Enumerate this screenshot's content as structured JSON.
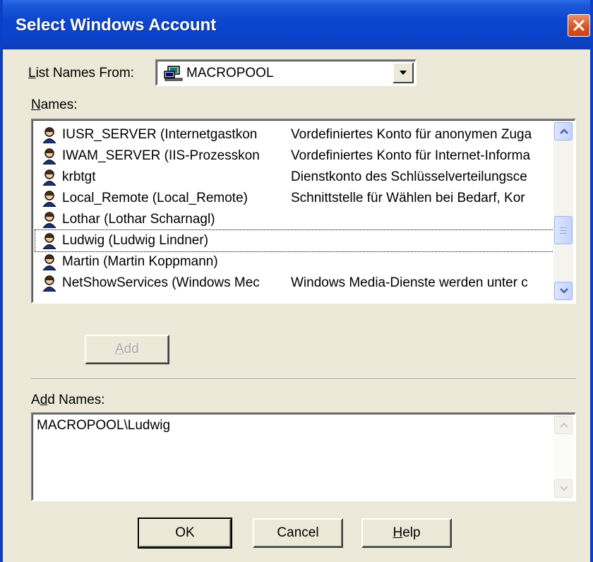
{
  "window": {
    "title": "Select Windows Account"
  },
  "list_names_from": {
    "label_access": "L",
    "label_rest": "ist Names From:",
    "value": "MACROPOOL"
  },
  "names": {
    "label_access": "N",
    "label_rest": "ames:",
    "rows": [
      {
        "name": "IUSR_SERVER (Internetgastkon",
        "description": "Vordefiniertes Konto für anonymen Zuga"
      },
      {
        "name": "IWAM_SERVER (IIS-Prozesskon",
        "description": "Vordefiniertes Konto für Internet-Informa"
      },
      {
        "name": "krbtgt",
        "description": "Dienstkonto des Schlüsselverteilungsce"
      },
      {
        "name": "Local_Remote (Local_Remote)",
        "description": "Schnittstelle für Wählen bei Bedarf, Kor"
      },
      {
        "name": "Lothar (Lothar Scharnagl)",
        "description": ""
      },
      {
        "name": "Ludwig (Ludwig Lindner)",
        "description": ""
      },
      {
        "name": "Martin (Martin Koppmann)",
        "description": ""
      },
      {
        "name": "NetShowServices (Windows Mec",
        "description": "Windows Media-Dienste werden unter c"
      }
    ]
  },
  "add_button": {
    "label_access": "A",
    "label_rest": "dd"
  },
  "add_names": {
    "label_pre": "A",
    "label_access": "d",
    "label_rest": "d Names:",
    "value": "MACROPOOL\\Ludwig"
  },
  "buttons": {
    "ok": "OK",
    "cancel": "Cancel",
    "help_access": "H",
    "help_rest": "elp"
  }
}
